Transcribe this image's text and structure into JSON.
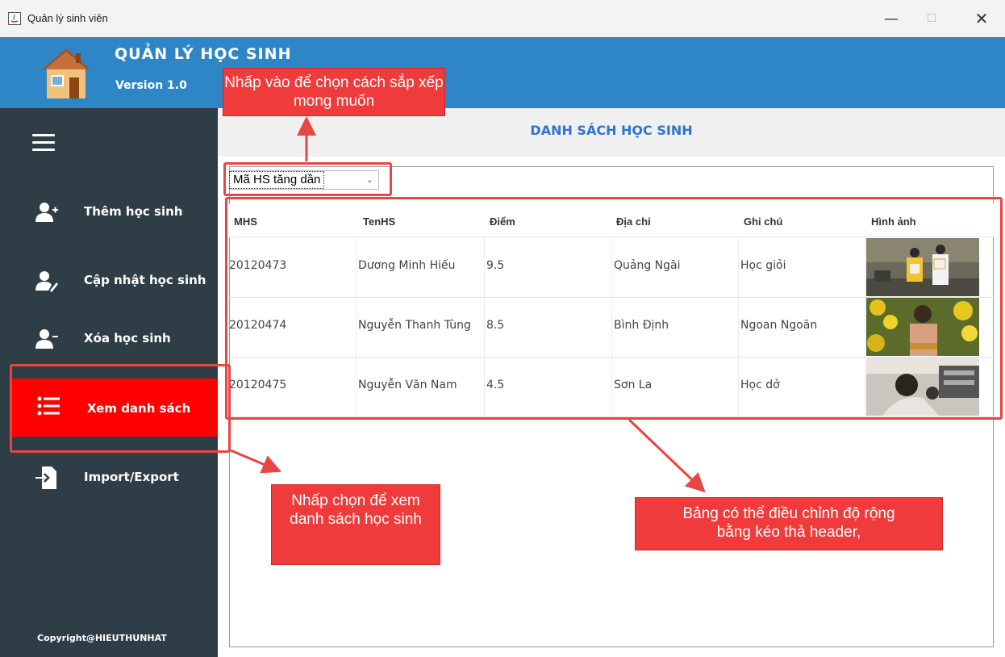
{
  "window": {
    "title": "Quản lý sinh viên",
    "minimize": "—",
    "maximize": "☐",
    "close": "✕"
  },
  "header": {
    "title": "QUẢN LÝ HỌC SINH",
    "version": "Version 1.0"
  },
  "sidebar": {
    "items": [
      {
        "label": "Thêm học sinh",
        "icon": "add-user-icon"
      },
      {
        "label": "Cập nhật học sinh",
        "icon": "edit-user-icon"
      },
      {
        "label": "Xóa học sinh",
        "icon": "remove-user-icon"
      },
      {
        "label": "Xem danh sách",
        "icon": "list-icon",
        "active": true
      },
      {
        "label": "Import/Export",
        "icon": "import-export-icon"
      }
    ],
    "copyright": "Copyright@HIEUTHUNHAT"
  },
  "main": {
    "title": "DANH SÁCH HỌC SINH",
    "sort": {
      "selected": "Mã HS tăng dần"
    },
    "table": {
      "columns": [
        "MHS",
        "TenHS",
        "Điểm",
        "Địa chỉ",
        "Ghi chú",
        "Hình ảnh"
      ],
      "rows": [
        {
          "mhs": "20120473",
          "name": "Dương Minh Hiếu",
          "score": "9.5",
          "address": "Quảng Ngãi",
          "note": "Học giỏi"
        },
        {
          "mhs": "20120474",
          "name": "Nguyễn Thanh Tùng",
          "score": "8.5",
          "address": "Bình Định",
          "note": "Ngoan Ngoãn"
        },
        {
          "mhs": "20120475",
          "name": "Nguyễn Văn Nam",
          "score": "4.5",
          "address": "Sơn La",
          "note": "Học dở"
        }
      ]
    }
  },
  "annotations": {
    "sort_hint": "Nhấp vào để chọn cách sắp xếp mong muốn",
    "view_hint": "Nhấp chọn để xem danh sách học sinh",
    "table_hint": "Bảng có thể điều chỉnh độ rộng bằng kéo thả header,"
  },
  "colors": {
    "header": "#2f86c6",
    "sidebar": "#2f3e46",
    "active": "#ff0000",
    "title": "#2f74d0",
    "annotation": "#ef3b3b"
  }
}
